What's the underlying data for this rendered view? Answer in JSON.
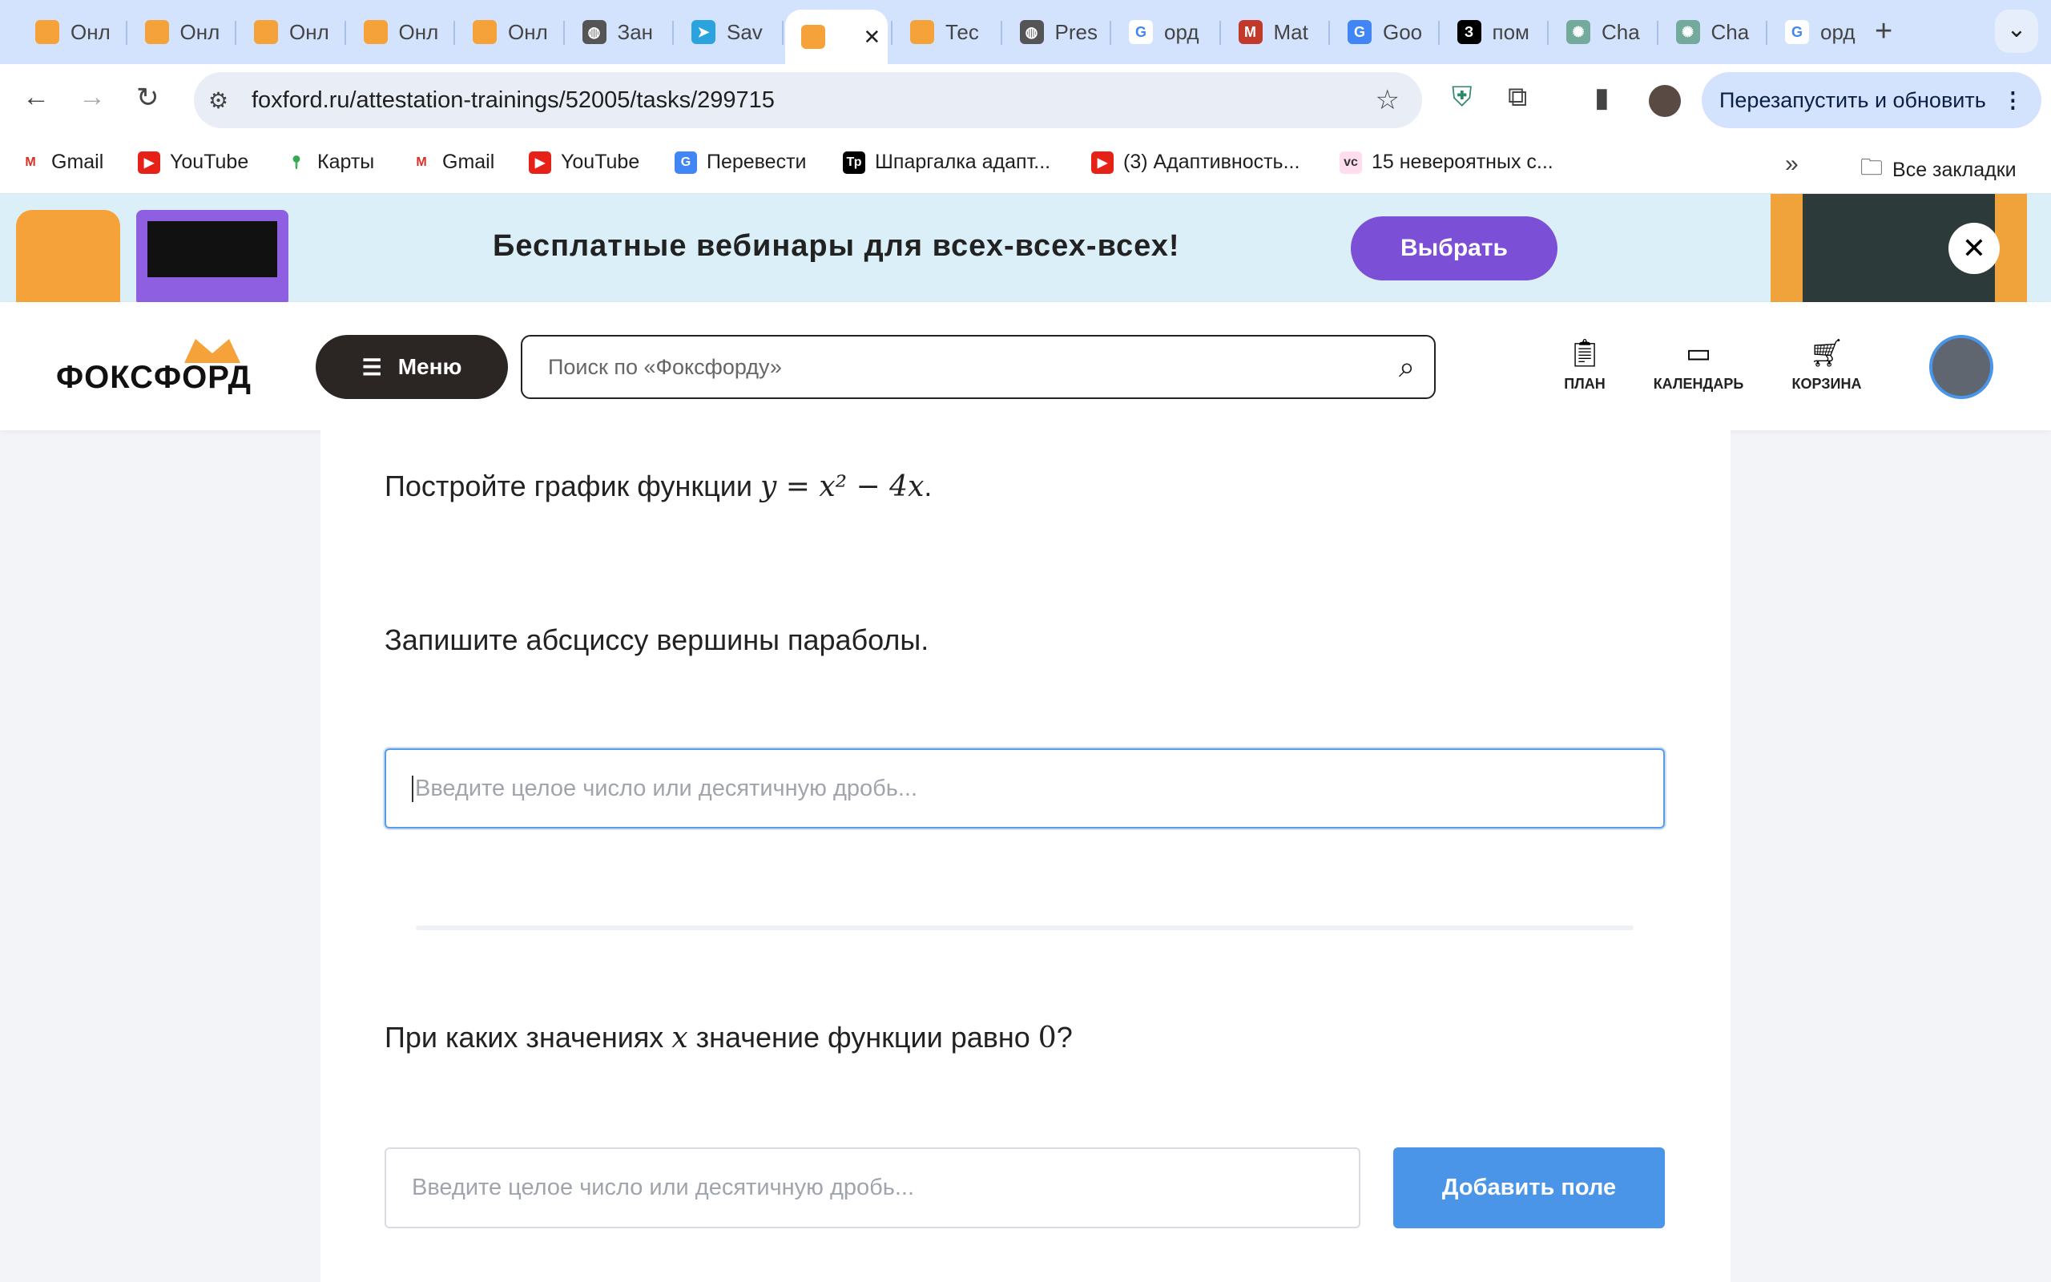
{
  "browser": {
    "tabs": [
      {
        "title": "Онл",
        "icon": "foxford-icon"
      },
      {
        "title": "Онл",
        "icon": "foxford-icon"
      },
      {
        "title": "Онл",
        "icon": "foxford-icon"
      },
      {
        "title": "Онл",
        "icon": "foxford-icon"
      },
      {
        "title": "Онл",
        "icon": "foxford-icon"
      },
      {
        "title": "Зан",
        "icon": "globe-icon"
      },
      {
        "title": "Sav",
        "icon": "telegram-icon"
      },
      {
        "title": "",
        "icon": "foxford-icon",
        "active": true
      },
      {
        "title": "Тес",
        "icon": "foxford-icon"
      },
      {
        "title": "Pres",
        "icon": "globe-icon"
      },
      {
        "title": "орд",
        "icon": "google-icon"
      },
      {
        "title": "Mat",
        "icon": "m-icon"
      },
      {
        "title": "Goo",
        "icon": "google-translate-icon"
      },
      {
        "title": "пом",
        "icon": "z-icon"
      },
      {
        "title": "Cha",
        "icon": "chatgpt-icon"
      },
      {
        "title": "Cha",
        "icon": "chatgpt-icon"
      },
      {
        "title": "орд",
        "icon": "google-icon"
      }
    ],
    "close_tab": "✕",
    "new_tab": "+",
    "tab_list": "⌄",
    "url": "foxford.ru/attestation-trainings/52005/tasks/299715",
    "restart_label": "Перезапустить и обновить",
    "bookmarks": [
      {
        "label": "Gmail",
        "icon": "gmail-icon"
      },
      {
        "label": "YouTube",
        "icon": "youtube-icon"
      },
      {
        "label": "Карты",
        "icon": "maps-icon"
      },
      {
        "label": "Gmail",
        "icon": "gmail-icon"
      },
      {
        "label": "YouTube",
        "icon": "youtube-icon"
      },
      {
        "label": "Перевести",
        "icon": "google-translate-icon"
      },
      {
        "label": "Шпаргалка адапт...",
        "icon": "tp-icon"
      },
      {
        "label": "(3) Адаптивность...",
        "icon": "youtube-icon"
      },
      {
        "label": "15 невероятных с...",
        "icon": "vc-icon"
      }
    ],
    "more_bookmarks": "»",
    "all_bookmarks": "Все закладки"
  },
  "banner": {
    "text": "Бесплатные вебинары для всех-всех-всех!",
    "button": "Выбрать",
    "close": "✕"
  },
  "header": {
    "logo": "ФОКСФОРД",
    "menu": "Меню",
    "search_placeholder": "Поиск по «Фоксфорду»",
    "nav": [
      {
        "label": "ПЛАН",
        "icon": "clipboard-icon"
      },
      {
        "label": "КАЛЕНДАРЬ",
        "icon": "calendar-icon"
      },
      {
        "label": "КОРЗИНА",
        "icon": "cart-icon"
      }
    ]
  },
  "task": {
    "statement_prefix": "Постройте график функции ",
    "statement_formula": "y = x² − 4x",
    "statement_suffix": ".",
    "q1": "Запишите абсциссу вершины параболы.",
    "q1_placeholder": "Введите целое число или десятичную дробь...",
    "q2_prefix": "При каких значениях ",
    "q2_var": "x",
    "q2_mid": " значение функции равно ",
    "q2_val": "0",
    "q2_suffix": "?",
    "q2_placeholder": "Введите целое число или десятичную дробь...",
    "add_field": "Добавить поле"
  },
  "colors": {
    "accent": "#4a95e8",
    "banner_button": "#7b4fd6",
    "menu_button": "#2b2523"
  }
}
